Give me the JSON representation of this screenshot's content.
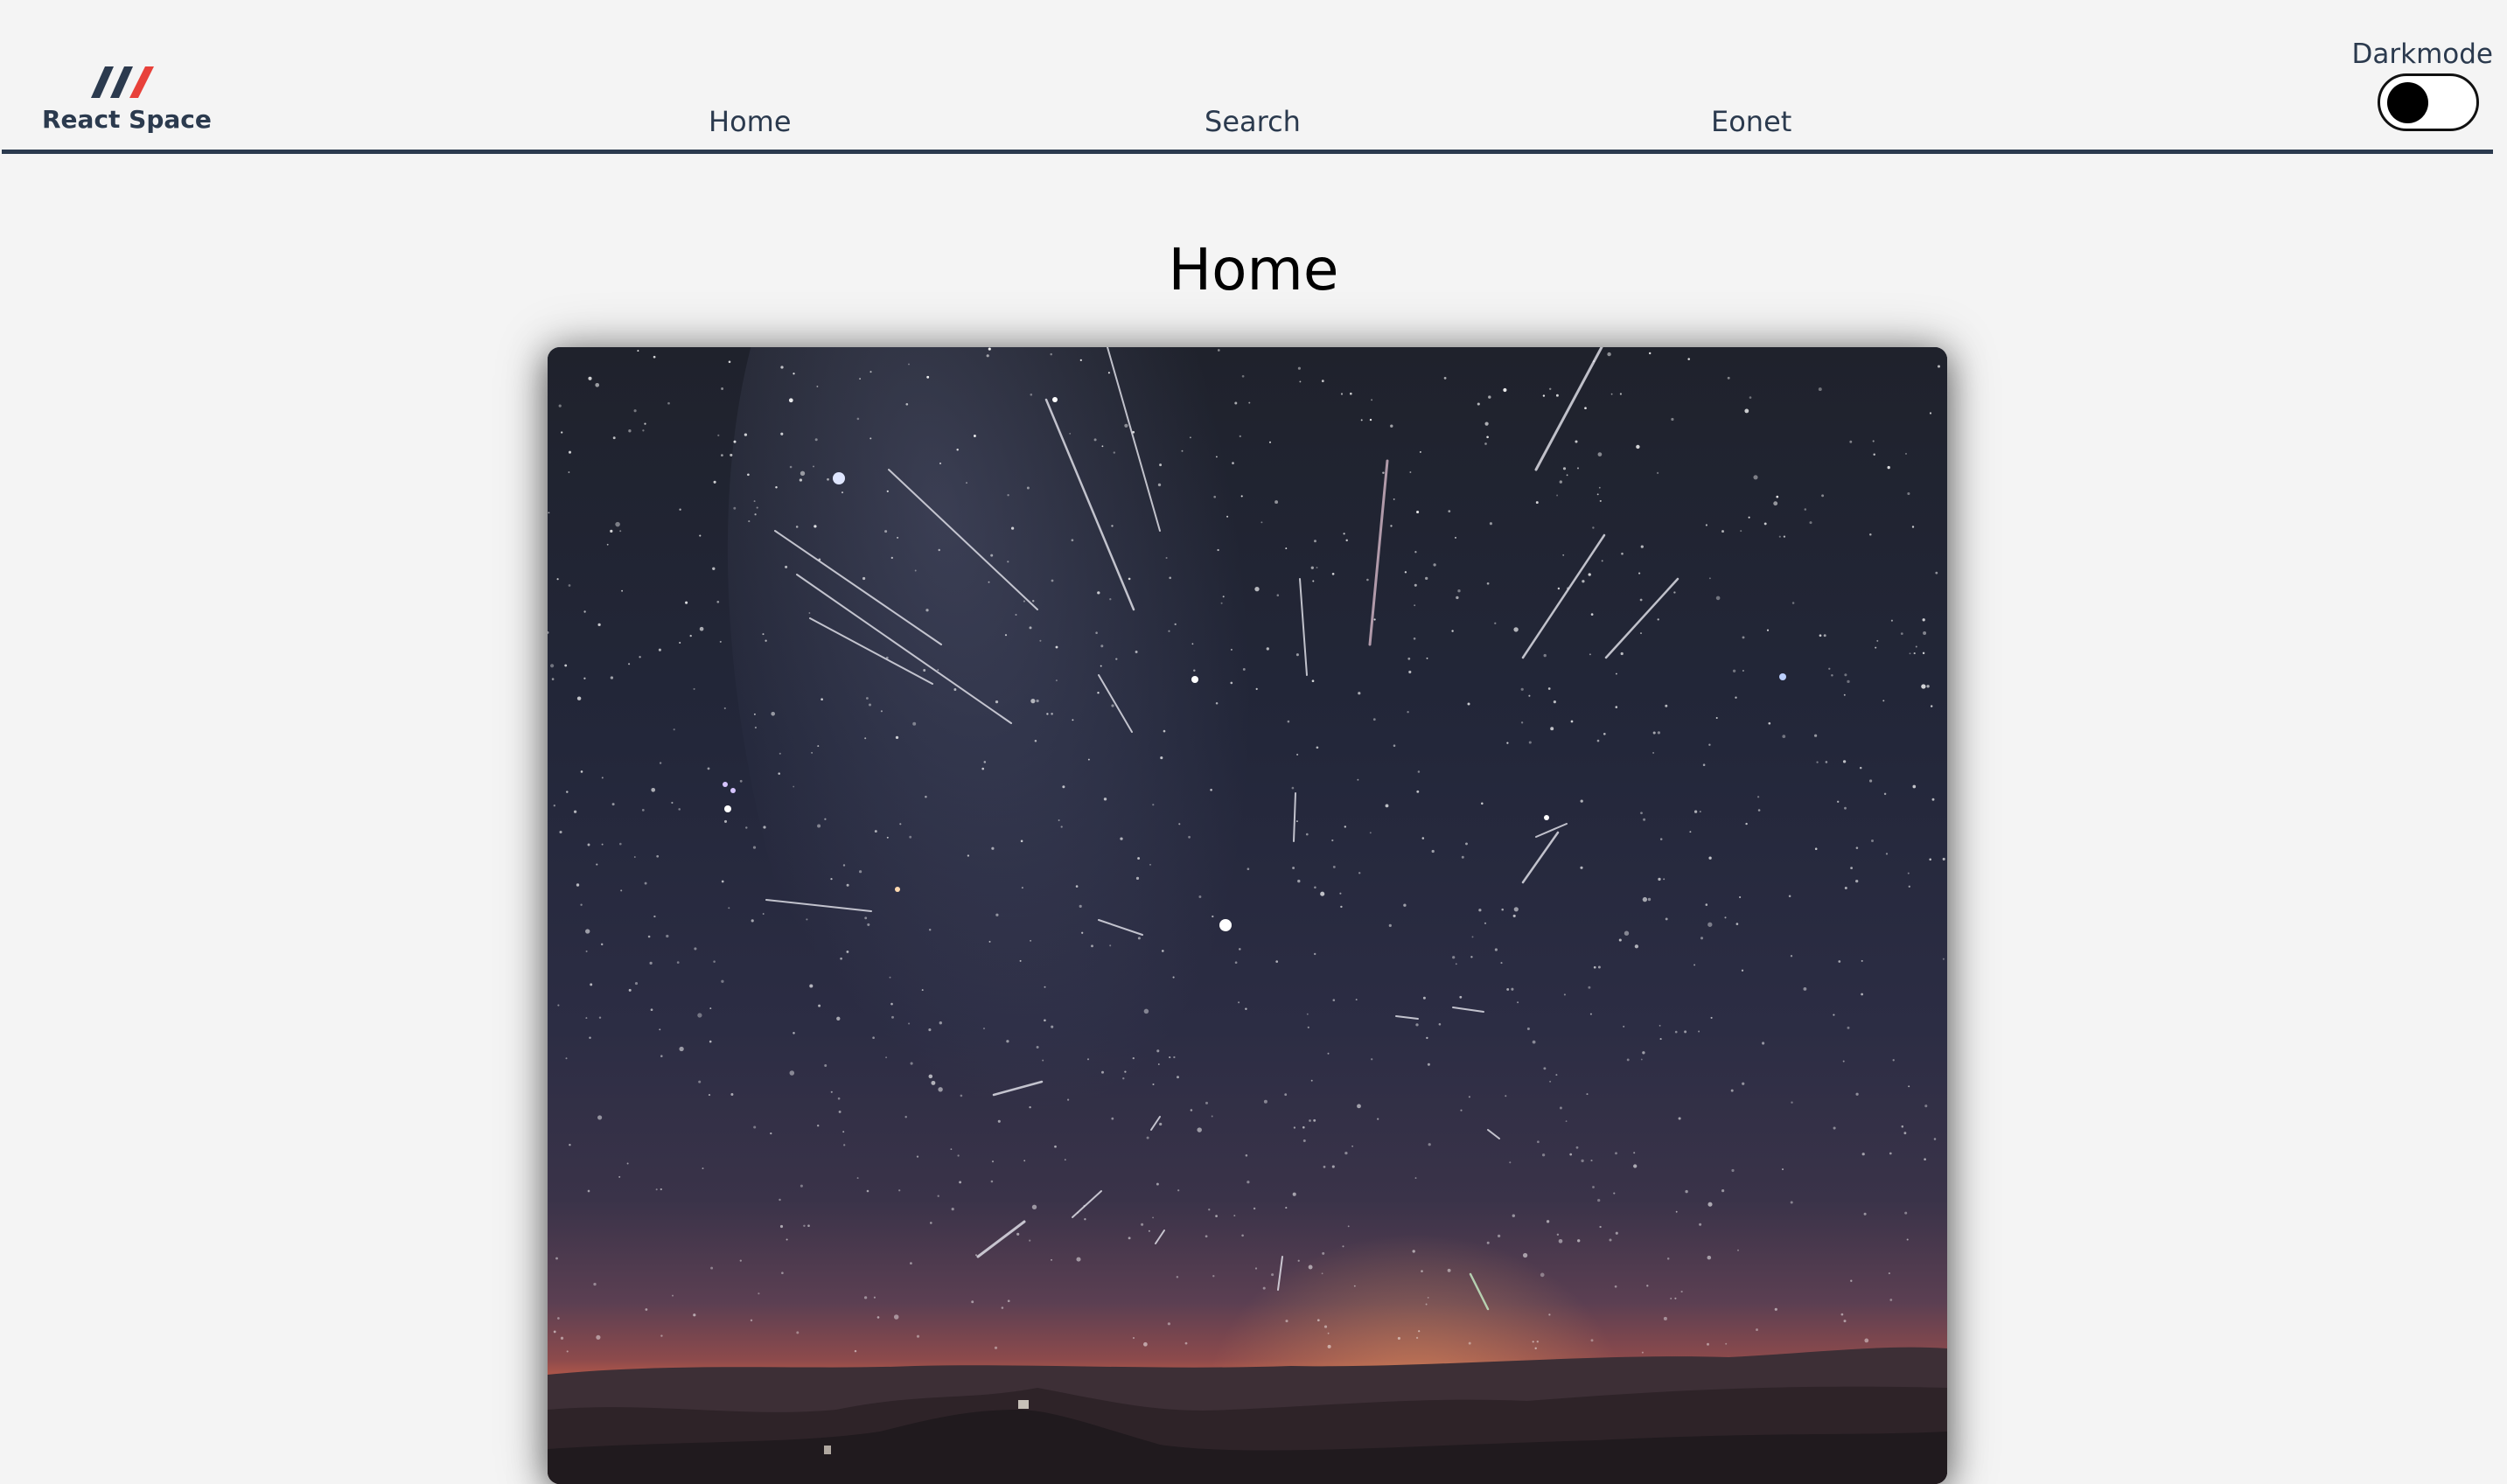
{
  "app": {
    "brand": "React Space",
    "brand_colors": {
      "navy": "#2b3a4e",
      "red": "#e8413a"
    }
  },
  "nav": {
    "links": [
      {
        "label": "Home"
      },
      {
        "label": "Search"
      },
      {
        "label": "Eonet"
      }
    ]
  },
  "darkmode": {
    "label": "Darkmode",
    "enabled": false
  },
  "main": {
    "title": "Home",
    "image": {
      "subject": "meteor-shower-night-sky-photo"
    }
  }
}
